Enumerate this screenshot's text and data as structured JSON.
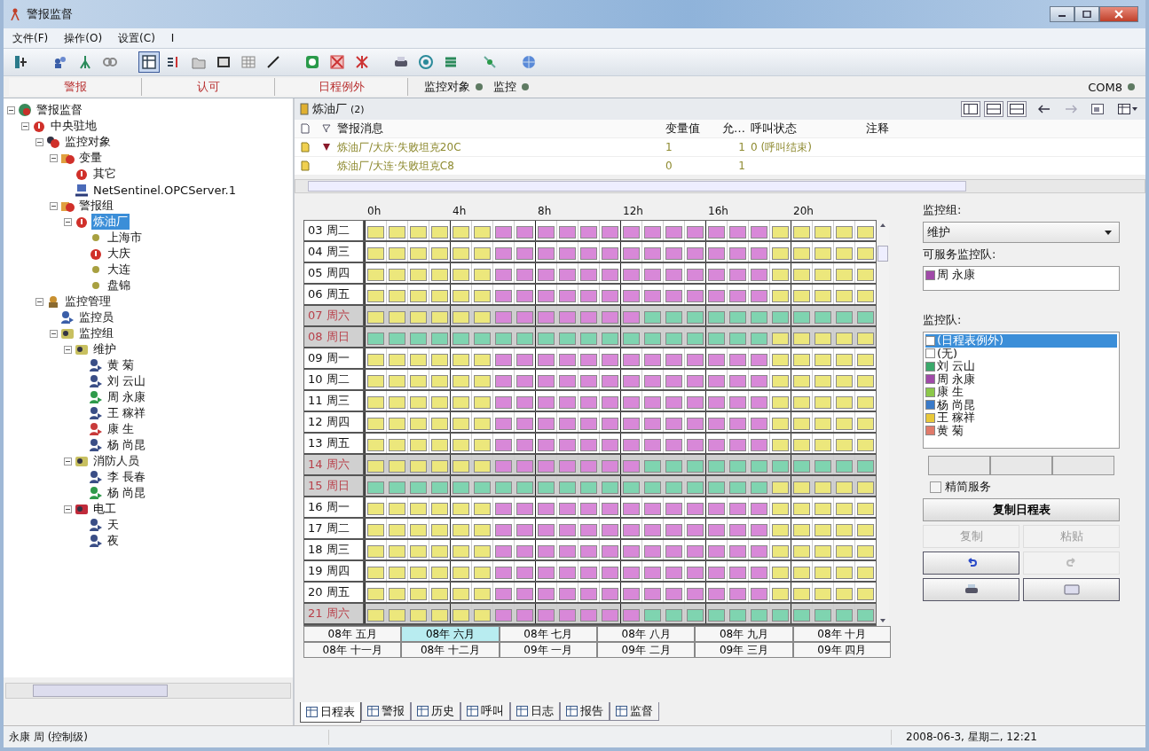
{
  "window": {
    "title": "警报监督"
  },
  "menu": [
    "文件(F)",
    "操作(O)",
    "设置(C)",
    "I"
  ],
  "toolbar": [
    {
      "pressed": false
    },
    {
      "pressed": false
    },
    {
      "pressed": false
    },
    {
      "pressed": false
    },
    {
      "pressed": true
    },
    {
      "pressed": false
    },
    {
      "pressed": false
    },
    {
      "pressed": false
    },
    {
      "pressed": false
    },
    {
      "pressed": false
    },
    {
      "pressed": false
    },
    {
      "pressed": false
    },
    {
      "pressed": false
    },
    {
      "pressed": false
    },
    {
      "pressed": false
    },
    {
      "pressed": false
    },
    {
      "pressed": false
    },
    {
      "pressed": false
    }
  ],
  "mode_tabs": [
    "警报",
    "认可",
    "日程例外"
  ],
  "indicators": [
    {
      "label": "监控对象",
      "color": "#5e7a62"
    },
    {
      "label": "监控",
      "color": "#5e7a62"
    },
    {
      "label": "COM8",
      "color": "#5e7a62"
    }
  ],
  "tree": {
    "label": "警报监督",
    "kind": "globe",
    "selected": false,
    "children": [
      {
        "label": "中央驻地",
        "kind": "alarm",
        "selected": false,
        "children": [
          {
            "label": "监控对象",
            "kind": "objects",
            "selected": false,
            "children": [
              {
                "label": "变量",
                "kind": "folder",
                "selected": false,
                "children": [
                  {
                    "label": "其它",
                    "kind": "alarm",
                    "selected": false
                  },
                  {
                    "label": "NetSentinel.OPCServer.1",
                    "kind": "server",
                    "selected": false
                  }
                ]
              },
              {
                "label": "警报组",
                "kind": "folder",
                "selected": false,
                "children": [
                  {
                    "label": "炼油厂",
                    "kind": "alarm",
                    "selected": true,
                    "children": [
                      {
                        "label": "上海市",
                        "kind": "dot",
                        "selected": false
                      },
                      {
                        "label": "大庆",
                        "kind": "alarm",
                        "selected": false
                      },
                      {
                        "label": "大连",
                        "kind": "dot",
                        "selected": false
                      },
                      {
                        "label": "盘锦",
                        "kind": "dot",
                        "selected": false
                      }
                    ]
                  }
                ]
              }
            ]
          },
          {
            "label": "监控管理",
            "kind": "manage",
            "selected": false,
            "children": [
              {
                "label": "监控员",
                "kind": "operator",
                "selected": false
              },
              {
                "label": "监控组",
                "kind": "team",
                "selected": false,
                "children": [
                  {
                    "label": "维护",
                    "kind": "team",
                    "selected": false,
                    "children": [
                      {
                        "label": "黄 菊",
                        "kind": "person",
                        "selected": false
                      },
                      {
                        "label": "刘 云山",
                        "kind": "person",
                        "selected": false
                      },
                      {
                        "label": "周 永康",
                        "kind": "person-green",
                        "selected": false
                      },
                      {
                        "label": "王 稼祥",
                        "kind": "person",
                        "selected": false
                      },
                      {
                        "label": "康 生",
                        "kind": "person-red",
                        "selected": false
                      },
                      {
                        "label": "杨 尚昆",
                        "kind": "person",
                        "selected": false
                      }
                    ]
                  },
                  {
                    "label": "消防人员",
                    "kind": "team",
                    "selected": false,
                    "children": [
                      {
                        "label": "李 長春",
                        "kind": "person",
                        "selected": false
                      },
                      {
                        "label": "杨 尚昆",
                        "kind": "person-green",
                        "selected": false
                      }
                    ]
                  },
                  {
                    "label": "电工",
                    "kind": "team-red",
                    "selected": false,
                    "children": [
                      {
                        "label": "天",
                        "kind": "person",
                        "selected": false
                      },
                      {
                        "label": "夜",
                        "kind": "person",
                        "selected": false
                      }
                    ]
                  }
                ]
              }
            ]
          }
        ]
      }
    ]
  },
  "alarm_panel": {
    "title": "炼油厂",
    "count": "(2)",
    "columns": [
      "警报消息",
      "变量值",
      "允…",
      "呼叫状态",
      "注释"
    ],
    "rows": [
      {
        "flagged": true,
        "message": "炼油厂/大庆·失败坦克20C",
        "value": "1",
        "ack": "1",
        "call_status": "0 (呼叫结束)"
      },
      {
        "flagged": false,
        "message": "炼油厂/大连·失败坦克C8",
        "value": "0",
        "ack": "1"
      }
    ]
  },
  "schedule": {
    "hour_labels": [
      "0h",
      "4h",
      "8h",
      "12h",
      "16h",
      "20h"
    ],
    "rows": [
      {
        "label": "03 周二",
        "weekend": false,
        "slots": [
          {
            "color": "#ece77c"
          },
          {
            "color": "#ece77c"
          },
          {
            "color": "#ece77c"
          },
          {
            "color": "#ece77c"
          },
          {
            "color": "#ece77c"
          },
          {
            "color": "#ece77c"
          },
          {
            "color": "#d888d8"
          },
          {
            "color": "#d888d8"
          },
          {
            "color": "#d888d8"
          },
          {
            "color": "#d888d8"
          },
          {
            "color": "#d888d8"
          },
          {
            "color": "#d888d8"
          },
          {
            "color": "#d888d8"
          },
          {
            "color": "#d888d8"
          },
          {
            "color": "#d888d8"
          },
          {
            "color": "#d888d8"
          },
          {
            "color": "#d888d8"
          },
          {
            "color": "#d888d8"
          },
          {
            "color": "#d888d8"
          },
          {
            "color": "#ece77c"
          },
          {
            "color": "#ece77c"
          },
          {
            "color": "#ece77c"
          },
          {
            "color": "#ece77c"
          },
          {
            "color": "#ece77c"
          }
        ]
      },
      {
        "label": "04 周三",
        "weekend": false,
        "slots": [
          {
            "color": "#ece77c"
          },
          {
            "color": "#ece77c"
          },
          {
            "color": "#ece77c"
          },
          {
            "color": "#ece77c"
          },
          {
            "color": "#ece77c"
          },
          {
            "color": "#ece77c"
          },
          {
            "color": "#d888d8"
          },
          {
            "color": "#d888d8"
          },
          {
            "color": "#d888d8"
          },
          {
            "color": "#d888d8"
          },
          {
            "color": "#d888d8"
          },
          {
            "color": "#d888d8"
          },
          {
            "color": "#d888d8"
          },
          {
            "color": "#d888d8"
          },
          {
            "color": "#d888d8"
          },
          {
            "color": "#d888d8"
          },
          {
            "color": "#d888d8"
          },
          {
            "color": "#d888d8"
          },
          {
            "color": "#d888d8"
          },
          {
            "color": "#ece77c"
          },
          {
            "color": "#ece77c"
          },
          {
            "color": "#ece77c"
          },
          {
            "color": "#ece77c"
          },
          {
            "color": "#ece77c"
          }
        ]
      },
      {
        "label": "05 周四",
        "weekend": false,
        "slots": [
          {
            "color": "#ece77c"
          },
          {
            "color": "#ece77c"
          },
          {
            "color": "#ece77c"
          },
          {
            "color": "#ece77c"
          },
          {
            "color": "#ece77c"
          },
          {
            "color": "#ece77c"
          },
          {
            "color": "#d888d8"
          },
          {
            "color": "#d888d8"
          },
          {
            "color": "#d888d8"
          },
          {
            "color": "#d888d8"
          },
          {
            "color": "#d888d8"
          },
          {
            "color": "#d888d8"
          },
          {
            "color": "#d888d8"
          },
          {
            "color": "#d888d8"
          },
          {
            "color": "#d888d8"
          },
          {
            "color": "#d888d8"
          },
          {
            "color": "#d888d8"
          },
          {
            "color": "#d888d8"
          },
          {
            "color": "#d888d8"
          },
          {
            "color": "#ece77c"
          },
          {
            "color": "#ece77c"
          },
          {
            "color": "#ece77c"
          },
          {
            "color": "#ece77c"
          },
          {
            "color": "#ece77c"
          }
        ]
      },
      {
        "label": "06 周五",
        "weekend": false,
        "slots": [
          {
            "color": "#ece77c"
          },
          {
            "color": "#ece77c"
          },
          {
            "color": "#ece77c"
          },
          {
            "color": "#ece77c"
          },
          {
            "color": "#ece77c"
          },
          {
            "color": "#ece77c"
          },
          {
            "color": "#d888d8"
          },
          {
            "color": "#d888d8"
          },
          {
            "color": "#d888d8"
          },
          {
            "color": "#d888d8"
          },
          {
            "color": "#d888d8"
          },
          {
            "color": "#d888d8"
          },
          {
            "color": "#d888d8"
          },
          {
            "color": "#d888d8"
          },
          {
            "color": "#d888d8"
          },
          {
            "color": "#d888d8"
          },
          {
            "color": "#d888d8"
          },
          {
            "color": "#d888d8"
          },
          {
            "color": "#d888d8"
          },
          {
            "color": "#ece77c"
          },
          {
            "color": "#ece77c"
          },
          {
            "color": "#ece77c"
          },
          {
            "color": "#ece77c"
          },
          {
            "color": "#ece77c"
          }
        ]
      },
      {
        "label": "07 周六",
        "weekend": true,
        "slots": [
          {
            "color": "#ece77c"
          },
          {
            "color": "#ece77c"
          },
          {
            "color": "#ece77c"
          },
          {
            "color": "#ece77c"
          },
          {
            "color": "#ece77c"
          },
          {
            "color": "#ece77c"
          },
          {
            "color": "#d888d8"
          },
          {
            "color": "#d888d8"
          },
          {
            "color": "#d888d8"
          },
          {
            "color": "#d888d8"
          },
          {
            "color": "#d888d8"
          },
          {
            "color": "#d888d8"
          },
          {
            "color": "#d888d8"
          },
          {
            "color": "#7fd4b0"
          },
          {
            "color": "#7fd4b0"
          },
          {
            "color": "#7fd4b0"
          },
          {
            "color": "#7fd4b0"
          },
          {
            "color": "#7fd4b0"
          },
          {
            "color": "#7fd4b0"
          },
          {
            "color": "#7fd4b0"
          },
          {
            "color": "#7fd4b0"
          },
          {
            "color": "#7fd4b0"
          },
          {
            "color": "#7fd4b0"
          },
          {
            "color": "#7fd4b0"
          }
        ]
      },
      {
        "label": "08 周日",
        "weekend": true,
        "slots": [
          {
            "color": "#7fd4b0"
          },
          {
            "color": "#7fd4b0"
          },
          {
            "color": "#7fd4b0"
          },
          {
            "color": "#7fd4b0"
          },
          {
            "color": "#7fd4b0"
          },
          {
            "color": "#7fd4b0"
          },
          {
            "color": "#7fd4b0"
          },
          {
            "color": "#7fd4b0"
          },
          {
            "color": "#7fd4b0"
          },
          {
            "color": "#7fd4b0"
          },
          {
            "color": "#7fd4b0"
          },
          {
            "color": "#7fd4b0"
          },
          {
            "color": "#7fd4b0"
          },
          {
            "color": "#7fd4b0"
          },
          {
            "color": "#7fd4b0"
          },
          {
            "color": "#7fd4b0"
          },
          {
            "color": "#7fd4b0"
          },
          {
            "color": "#7fd4b0"
          },
          {
            "color": "#7fd4b0"
          },
          {
            "color": "#ece77c"
          },
          {
            "color": "#ece77c"
          },
          {
            "color": "#ece77c"
          },
          {
            "color": "#ece77c"
          },
          {
            "color": "#ece77c"
          }
        ]
      },
      {
        "label": "09 周一",
        "weekend": false,
        "slots": [
          {
            "color": "#ece77c"
          },
          {
            "color": "#ece77c"
          },
          {
            "color": "#ece77c"
          },
          {
            "color": "#ece77c"
          },
          {
            "color": "#ece77c"
          },
          {
            "color": "#ece77c"
          },
          {
            "color": "#d888d8"
          },
          {
            "color": "#d888d8"
          },
          {
            "color": "#d888d8"
          },
          {
            "color": "#d888d8"
          },
          {
            "color": "#d888d8"
          },
          {
            "color": "#d888d8"
          },
          {
            "color": "#d888d8"
          },
          {
            "color": "#d888d8"
          },
          {
            "color": "#d888d8"
          },
          {
            "color": "#d888d8"
          },
          {
            "color": "#d888d8"
          },
          {
            "color": "#d888d8"
          },
          {
            "color": "#d888d8"
          },
          {
            "color": "#ece77c"
          },
          {
            "color": "#ece77c"
          },
          {
            "color": "#ece77c"
          },
          {
            "color": "#ece77c"
          },
          {
            "color": "#ece77c"
          }
        ]
      },
      {
        "label": "10 周二",
        "weekend": false,
        "slots": [
          {
            "color": "#ece77c"
          },
          {
            "color": "#ece77c"
          },
          {
            "color": "#ece77c"
          },
          {
            "color": "#ece77c"
          },
          {
            "color": "#ece77c"
          },
          {
            "color": "#ece77c"
          },
          {
            "color": "#d888d8"
          },
          {
            "color": "#d888d8"
          },
          {
            "color": "#d888d8"
          },
          {
            "color": "#d888d8"
          },
          {
            "color": "#d888d8"
          },
          {
            "color": "#d888d8"
          },
          {
            "color": "#d888d8"
          },
          {
            "color": "#d888d8"
          },
          {
            "color": "#d888d8"
          },
          {
            "color": "#d888d8"
          },
          {
            "color": "#d888d8"
          },
          {
            "color": "#d888d8"
          },
          {
            "color": "#d888d8"
          },
          {
            "color": "#ece77c"
          },
          {
            "color": "#ece77c"
          },
          {
            "color": "#ece77c"
          },
          {
            "color": "#ece77c"
          },
          {
            "color": "#ece77c"
          }
        ]
      },
      {
        "label": "11 周三",
        "weekend": false,
        "slots": [
          {
            "color": "#ece77c"
          },
          {
            "color": "#ece77c"
          },
          {
            "color": "#ece77c"
          },
          {
            "color": "#ece77c"
          },
          {
            "color": "#ece77c"
          },
          {
            "color": "#ece77c"
          },
          {
            "color": "#d888d8"
          },
          {
            "color": "#d888d8"
          },
          {
            "color": "#d888d8"
          },
          {
            "color": "#d888d8"
          },
          {
            "color": "#d888d8"
          },
          {
            "color": "#d888d8"
          },
          {
            "color": "#d888d8"
          },
          {
            "color": "#d888d8"
          },
          {
            "color": "#d888d8"
          },
          {
            "color": "#d888d8"
          },
          {
            "color": "#d888d8"
          },
          {
            "color": "#d888d8"
          },
          {
            "color": "#d888d8"
          },
          {
            "color": "#ece77c"
          },
          {
            "color": "#ece77c"
          },
          {
            "color": "#ece77c"
          },
          {
            "color": "#ece77c"
          },
          {
            "color": "#ece77c"
          }
        ]
      },
      {
        "label": "12 周四",
        "weekend": false,
        "slots": [
          {
            "color": "#ece77c"
          },
          {
            "color": "#ece77c"
          },
          {
            "color": "#ece77c"
          },
          {
            "color": "#ece77c"
          },
          {
            "color": "#ece77c"
          },
          {
            "color": "#ece77c"
          },
          {
            "color": "#d888d8"
          },
          {
            "color": "#d888d8"
          },
          {
            "color": "#d888d8"
          },
          {
            "color": "#d888d8"
          },
          {
            "color": "#d888d8"
          },
          {
            "color": "#d888d8"
          },
          {
            "color": "#d888d8"
          },
          {
            "color": "#d888d8"
          },
          {
            "color": "#d888d8"
          },
          {
            "color": "#d888d8"
          },
          {
            "color": "#d888d8"
          },
          {
            "color": "#d888d8"
          },
          {
            "color": "#d888d8"
          },
          {
            "color": "#ece77c"
          },
          {
            "color": "#ece77c"
          },
          {
            "color": "#ece77c"
          },
          {
            "color": "#ece77c"
          },
          {
            "color": "#ece77c"
          }
        ]
      },
      {
        "label": "13 周五",
        "weekend": false,
        "slots": [
          {
            "color": "#ece77c"
          },
          {
            "color": "#ece77c"
          },
          {
            "color": "#ece77c"
          },
          {
            "color": "#ece77c"
          },
          {
            "color": "#ece77c"
          },
          {
            "color": "#ece77c"
          },
          {
            "color": "#d888d8"
          },
          {
            "color": "#d888d8"
          },
          {
            "color": "#d888d8"
          },
          {
            "color": "#d888d8"
          },
          {
            "color": "#d888d8"
          },
          {
            "color": "#d888d8"
          },
          {
            "color": "#d888d8"
          },
          {
            "color": "#d888d8"
          },
          {
            "color": "#d888d8"
          },
          {
            "color": "#d888d8"
          },
          {
            "color": "#d888d8"
          },
          {
            "color": "#d888d8"
          },
          {
            "color": "#d888d8"
          },
          {
            "color": "#ece77c"
          },
          {
            "color": "#ece77c"
          },
          {
            "color": "#ece77c"
          },
          {
            "color": "#ece77c"
          },
          {
            "color": "#ece77c"
          }
        ]
      },
      {
        "label": "14 周六",
        "weekend": true,
        "slots": [
          {
            "color": "#ece77c"
          },
          {
            "color": "#ece77c"
          },
          {
            "color": "#ece77c"
          },
          {
            "color": "#ece77c"
          },
          {
            "color": "#ece77c"
          },
          {
            "color": "#ece77c"
          },
          {
            "color": "#d888d8"
          },
          {
            "color": "#d888d8"
          },
          {
            "color": "#d888d8"
          },
          {
            "color": "#d888d8"
          },
          {
            "color": "#d888d8"
          },
          {
            "color": "#d888d8"
          },
          {
            "color": "#d888d8"
          },
          {
            "color": "#7fd4b0"
          },
          {
            "color": "#7fd4b0"
          },
          {
            "color": "#7fd4b0"
          },
          {
            "color": "#7fd4b0"
          },
          {
            "color": "#7fd4b0"
          },
          {
            "color": "#7fd4b0"
          },
          {
            "color": "#7fd4b0"
          },
          {
            "color": "#7fd4b0"
          },
          {
            "color": "#7fd4b0"
          },
          {
            "color": "#7fd4b0"
          },
          {
            "color": "#7fd4b0"
          }
        ]
      },
      {
        "label": "15 周日",
        "weekend": true,
        "slots": [
          {
            "color": "#7fd4b0"
          },
          {
            "color": "#7fd4b0"
          },
          {
            "color": "#7fd4b0"
          },
          {
            "color": "#7fd4b0"
          },
          {
            "color": "#7fd4b0"
          },
          {
            "color": "#7fd4b0"
          },
          {
            "color": "#7fd4b0"
          },
          {
            "color": "#7fd4b0"
          },
          {
            "color": "#7fd4b0"
          },
          {
            "color": "#7fd4b0"
          },
          {
            "color": "#7fd4b0"
          },
          {
            "color": "#7fd4b0"
          },
          {
            "color": "#7fd4b0"
          },
          {
            "color": "#7fd4b0"
          },
          {
            "color": "#7fd4b0"
          },
          {
            "color": "#7fd4b0"
          },
          {
            "color": "#7fd4b0"
          },
          {
            "color": "#7fd4b0"
          },
          {
            "color": "#7fd4b0"
          },
          {
            "color": "#ece77c"
          },
          {
            "color": "#ece77c"
          },
          {
            "color": "#ece77c"
          },
          {
            "color": "#ece77c"
          },
          {
            "color": "#ece77c"
          }
        ]
      },
      {
        "label": "16 周一",
        "weekend": false,
        "slots": [
          {
            "color": "#ece77c"
          },
          {
            "color": "#ece77c"
          },
          {
            "color": "#ece77c"
          },
          {
            "color": "#ece77c"
          },
          {
            "color": "#ece77c"
          },
          {
            "color": "#ece77c"
          },
          {
            "color": "#d888d8"
          },
          {
            "color": "#d888d8"
          },
          {
            "color": "#d888d8"
          },
          {
            "color": "#d888d8"
          },
          {
            "color": "#d888d8"
          },
          {
            "color": "#d888d8"
          },
          {
            "color": "#d888d8"
          },
          {
            "color": "#d888d8"
          },
          {
            "color": "#d888d8"
          },
          {
            "color": "#d888d8"
          },
          {
            "color": "#d888d8"
          },
          {
            "color": "#d888d8"
          },
          {
            "color": "#d888d8"
          },
          {
            "color": "#ece77c"
          },
          {
            "color": "#ece77c"
          },
          {
            "color": "#ece77c"
          },
          {
            "color": "#ece77c"
          },
          {
            "color": "#ece77c"
          }
        ]
      },
      {
        "label": "17 周二",
        "weekend": false,
        "slots": [
          {
            "color": "#ece77c"
          },
          {
            "color": "#ece77c"
          },
          {
            "color": "#ece77c"
          },
          {
            "color": "#ece77c"
          },
          {
            "color": "#ece77c"
          },
          {
            "color": "#ece77c"
          },
          {
            "color": "#d888d8"
          },
          {
            "color": "#d888d8"
          },
          {
            "color": "#d888d8"
          },
          {
            "color": "#d888d8"
          },
          {
            "color": "#d888d8"
          },
          {
            "color": "#d888d8"
          },
          {
            "color": "#d888d8"
          },
          {
            "color": "#d888d8"
          },
          {
            "color": "#d888d8"
          },
          {
            "color": "#d888d8"
          },
          {
            "color": "#d888d8"
          },
          {
            "color": "#d888d8"
          },
          {
            "color": "#d888d8"
          },
          {
            "color": "#ece77c"
          },
          {
            "color": "#ece77c"
          },
          {
            "color": "#ece77c"
          },
          {
            "color": "#ece77c"
          },
          {
            "color": "#ece77c"
          }
        ]
      },
      {
        "label": "18 周三",
        "weekend": false,
        "slots": [
          {
            "color": "#ece77c"
          },
          {
            "color": "#ece77c"
          },
          {
            "color": "#ece77c"
          },
          {
            "color": "#ece77c"
          },
          {
            "color": "#ece77c"
          },
          {
            "color": "#ece77c"
          },
          {
            "color": "#d888d8"
          },
          {
            "color": "#d888d8"
          },
          {
            "color": "#d888d8"
          },
          {
            "color": "#d888d8"
          },
          {
            "color": "#d888d8"
          },
          {
            "color": "#d888d8"
          },
          {
            "color": "#d888d8"
          },
          {
            "color": "#d888d8"
          },
          {
            "color": "#d888d8"
          },
          {
            "color": "#d888d8"
          },
          {
            "color": "#d888d8"
          },
          {
            "color": "#d888d8"
          },
          {
            "color": "#d888d8"
          },
          {
            "color": "#ece77c"
          },
          {
            "color": "#ece77c"
          },
          {
            "color": "#ece77c"
          },
          {
            "color": "#ece77c"
          },
          {
            "color": "#ece77c"
          }
        ]
      },
      {
        "label": "19 周四",
        "weekend": false,
        "slots": [
          {
            "color": "#ece77c"
          },
          {
            "color": "#ece77c"
          },
          {
            "color": "#ece77c"
          },
          {
            "color": "#ece77c"
          },
          {
            "color": "#ece77c"
          },
          {
            "color": "#ece77c"
          },
          {
            "color": "#d888d8"
          },
          {
            "color": "#d888d8"
          },
          {
            "color": "#d888d8"
          },
          {
            "color": "#d888d8"
          },
          {
            "color": "#d888d8"
          },
          {
            "color": "#d888d8"
          },
          {
            "color": "#d888d8"
          },
          {
            "color": "#d888d8"
          },
          {
            "color": "#d888d8"
          },
          {
            "color": "#d888d8"
          },
          {
            "color": "#d888d8"
          },
          {
            "color": "#d888d8"
          },
          {
            "color": "#d888d8"
          },
          {
            "color": "#ece77c"
          },
          {
            "color": "#ece77c"
          },
          {
            "color": "#ece77c"
          },
          {
            "color": "#ece77c"
          },
          {
            "color": "#ece77c"
          }
        ]
      },
      {
        "label": "20 周五",
        "weekend": false,
        "slots": [
          {
            "color": "#ece77c"
          },
          {
            "color": "#ece77c"
          },
          {
            "color": "#ece77c"
          },
          {
            "color": "#ece77c"
          },
          {
            "color": "#ece77c"
          },
          {
            "color": "#ece77c"
          },
          {
            "color": "#d888d8"
          },
          {
            "color": "#d888d8"
          },
          {
            "color": "#d888d8"
          },
          {
            "color": "#d888d8"
          },
          {
            "color": "#d888d8"
          },
          {
            "color": "#d888d8"
          },
          {
            "color": "#d888d8"
          },
          {
            "color": "#d888d8"
          },
          {
            "color": "#d888d8"
          },
          {
            "color": "#d888d8"
          },
          {
            "color": "#d888d8"
          },
          {
            "color": "#d888d8"
          },
          {
            "color": "#d888d8"
          },
          {
            "color": "#ece77c"
          },
          {
            "color": "#ece77c"
          },
          {
            "color": "#ece77c"
          },
          {
            "color": "#ece77c"
          },
          {
            "color": "#ece77c"
          }
        ]
      },
      {
        "label": "21 周六",
        "weekend": true,
        "slots": [
          {
            "color": "#ece77c"
          },
          {
            "color": "#ece77c"
          },
          {
            "color": "#ece77c"
          },
          {
            "color": "#ece77c"
          },
          {
            "color": "#ece77c"
          },
          {
            "color": "#ece77c"
          },
          {
            "color": "#d888d8"
          },
          {
            "color": "#d888d8"
          },
          {
            "color": "#d888d8"
          },
          {
            "color": "#d888d8"
          },
          {
            "color": "#d888d8"
          },
          {
            "color": "#d888d8"
          },
          {
            "color": "#d888d8"
          },
          {
            "color": "#7fd4b0"
          },
          {
            "color": "#7fd4b0"
          },
          {
            "color": "#7fd4b0"
          },
          {
            "color": "#7fd4b0"
          },
          {
            "color": "#7fd4b0"
          },
          {
            "color": "#7fd4b0"
          },
          {
            "color": "#7fd4b0"
          },
          {
            "color": "#7fd4b0"
          },
          {
            "color": "#7fd4b0"
          },
          {
            "color": "#7fd4b0"
          },
          {
            "color": "#7fd4b0"
          }
        ]
      }
    ],
    "months": [
      {
        "label": "08年 五月",
        "selected": false
      },
      {
        "label": "08年 六月",
        "selected": true
      },
      {
        "label": "08年 七月",
        "selected": false
      },
      {
        "label": "08年 八月",
        "selected": false
      },
      {
        "label": "08年 九月",
        "selected": false
      },
      {
        "label": "08年 十月",
        "selected": false
      },
      {
        "label": "08年 十一月",
        "selected": false
      },
      {
        "label": "08年 十二月",
        "selected": false
      },
      {
        "label": "09年 一月",
        "selected": false
      },
      {
        "label": "09年 二月",
        "selected": false
      },
      {
        "label": "09年 三月",
        "selected": false
      },
      {
        "label": "09年 四月",
        "selected": false
      }
    ]
  },
  "side_panel": {
    "group_label": "监控组:",
    "group_value": "维护",
    "service_label": "可服务监控队:",
    "service_teams": [
      {
        "name": "周 永康",
        "color": "#a04aa8"
      }
    ],
    "teams_label": "监控队:",
    "teams": [
      {
        "name": "(日程表例外)",
        "color": "#ffffff",
        "selected": true
      },
      {
        "name": "(无)",
        "color": "#ffffff",
        "selected": false
      },
      {
        "name": "刘 云山",
        "color": "#3aa86a",
        "selected": false
      },
      {
        "name": "周 永康",
        "color": "#a04aa8",
        "selected": false
      },
      {
        "name": "康 生",
        "color": "#8cc84a",
        "selected": false
      },
      {
        "name": "杨 尚昆",
        "color": "#3a7ac8",
        "selected": false
      },
      {
        "name": "王 稼祥",
        "color": "#e8c83a",
        "selected": false
      },
      {
        "name": "黄 菊",
        "color": "#e07a6a",
        "selected": false
      }
    ],
    "simplify": {
      "label": "精简服务",
      "checked": false
    },
    "copy_schedule": "复制日程表",
    "copy": {
      "label": "复制",
      "disabled": true
    },
    "paste": {
      "label": "粘贴",
      "disabled": true
    },
    "undo_disabled": false,
    "redo_disabled": true
  },
  "bottom_tabs": [
    {
      "label": "日程表",
      "selected": true
    },
    {
      "label": "警报",
      "selected": false
    },
    {
      "label": "历史",
      "selected": false
    },
    {
      "label": "呼叫",
      "selected": false
    },
    {
      "label": "日志",
      "selected": false
    },
    {
      "label": "报告",
      "selected": false
    },
    {
      "label": "监督",
      "selected": false
    }
  ],
  "status_bar": {
    "user": "永康 周 (控制级)",
    "datetime": "2008-06-3, 星期二, 12:21"
  }
}
